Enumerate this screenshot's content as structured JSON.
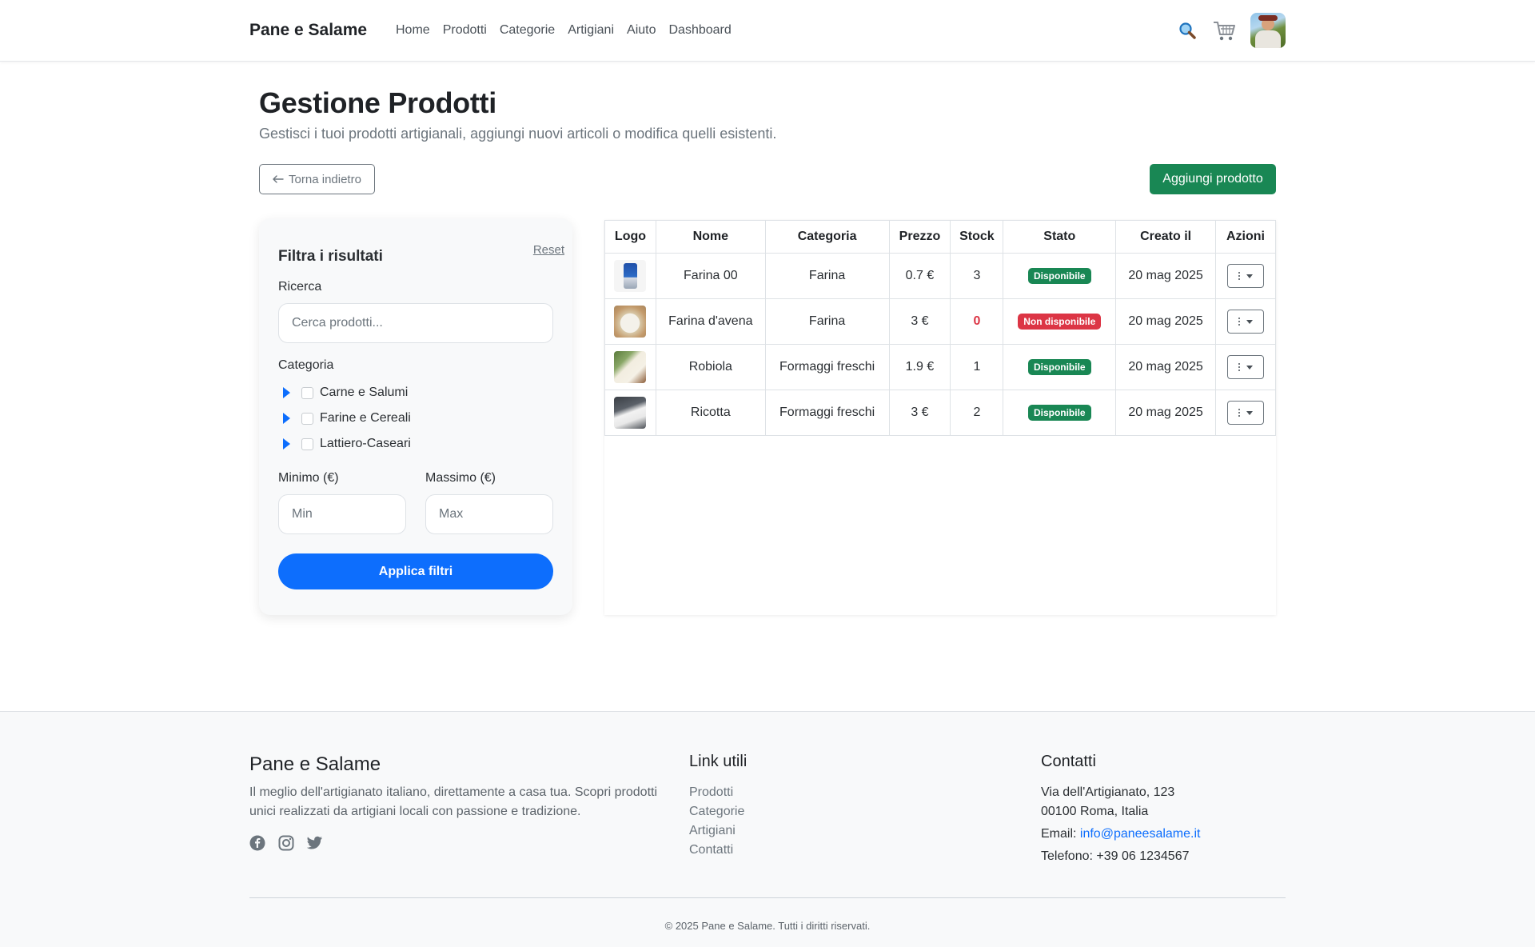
{
  "navbar": {
    "brand": "Pane e Salame",
    "links": [
      "Home",
      "Prodotti",
      "Categorie",
      "Artigiani",
      "Aiuto",
      "Dashboard"
    ],
    "icons": [
      "search-icon",
      "cart-icon",
      "avatar"
    ]
  },
  "header": {
    "title": "Gestione Prodotti",
    "subtitle": "Gestisci i tuoi prodotti artigianali, aggiungi nuovi articoli o modifica quelli esistenti."
  },
  "actions": {
    "back_label": "Torna indietro",
    "add_label": "Aggiungi prodotto"
  },
  "filters": {
    "title": "Filtra i risultati",
    "reset_label": "Reset",
    "search_label": "Ricerca",
    "search_placeholder": "Cerca prodotti...",
    "category_label": "Categoria",
    "categories": [
      "Carne e Salumi",
      "Farine e Cereali",
      "Lattiero-Caseari"
    ],
    "min_label": "Minimo (€)",
    "max_label": "Massimo (€)",
    "min_placeholder": "Min",
    "max_placeholder": "Max",
    "apply_label": "Applica filtri"
  },
  "table": {
    "headers": [
      "Logo",
      "Nome",
      "Categoria",
      "Prezzo",
      "Stock",
      "Stato",
      "Creato il",
      "Azioni"
    ],
    "rows": [
      {
        "name": "Farina 00",
        "category": "Farina",
        "price": "0.7 €",
        "stock": "3",
        "status": "Disponibile",
        "created": "20 mag 2025"
      },
      {
        "name": "Farina d'avena",
        "category": "Farina",
        "price": "3 €",
        "stock": "0",
        "status": "Non disponibile",
        "created": "20 mag 2025"
      },
      {
        "name": "Robiola",
        "category": "Formaggi freschi",
        "price": "1.9 €",
        "stock": "1",
        "status": "Disponibile",
        "created": "20 mag 2025"
      },
      {
        "name": "Ricotta",
        "category": "Formaggi freschi",
        "price": "3 €",
        "stock": "2",
        "status": "Disponibile",
        "created": "20 mag 2025"
      }
    ]
  },
  "footer": {
    "brand": "Pane e Salame",
    "description": "Il meglio dell'artigianato italiano, direttamente a casa tua. Scopri prodotti unici realizzati da artigiani locali con passione e tradizione.",
    "social_icons": [
      "facebook-icon",
      "instagram-icon",
      "twitter-icon"
    ],
    "links_title": "Link utili",
    "links": [
      "Prodotti",
      "Categorie",
      "Artigiani",
      "Contatti"
    ],
    "contacts_title": "Contatti",
    "address_line1": "Via dell'Artigianato, 123",
    "address_line2": "00100 Roma, Italia",
    "email_prefix": "Email: ",
    "email": "info@paneesalame.it",
    "phone": "Telefono: +39 06 1234567",
    "copyright": "© 2025 Pane e Salame. Tutti i diritti riservati."
  },
  "colors": {
    "primary": "#0d6efd",
    "success": "#198754",
    "danger": "#dc3545"
  }
}
